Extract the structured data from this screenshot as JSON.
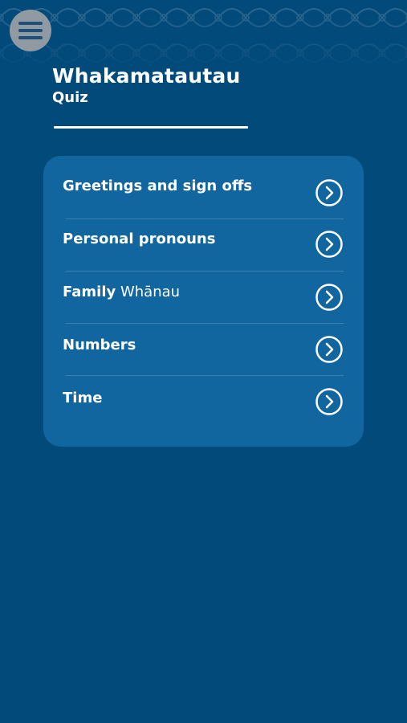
{
  "header": {
    "menu_icon": "hamburger-menu-icon",
    "title": "Whakamatautau",
    "subtitle": "Quiz"
  },
  "topics": [
    {
      "label": "Greetings and sign offs",
      "label_maori": "",
      "icon": "chevron-right-circle-icon"
    },
    {
      "label": "Personal pronouns",
      "label_maori": "",
      "icon": "chevron-right-circle-icon"
    },
    {
      "label": "Family",
      "label_maori": "Whānau",
      "icon": "chevron-right-circle-icon"
    },
    {
      "label": "Numbers",
      "label_maori": "",
      "icon": "chevron-right-circle-icon"
    },
    {
      "label": "Time",
      "label_maori": "",
      "icon": "chevron-right-circle-icon"
    }
  ],
  "colors": {
    "background": "#024a7a",
    "card": "#1266a0",
    "text": "#ffffff",
    "menu_button": "#8f9aa3"
  }
}
